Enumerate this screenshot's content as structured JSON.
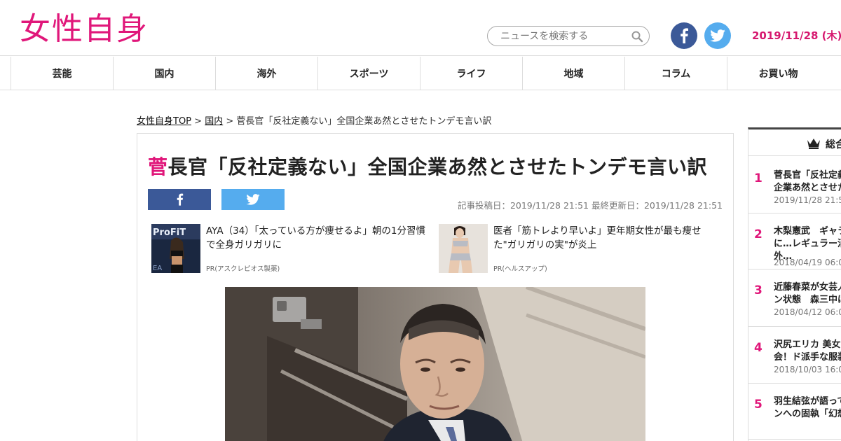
{
  "header": {
    "logo": "女性自身",
    "search_placeholder": "ニュースを検索する",
    "date": "2019/11/28 (木)"
  },
  "nav": {
    "items": [
      "芸能",
      "国内",
      "海外",
      "スポーツ",
      "ライフ",
      "地域",
      "コラム",
      "お買い物"
    ]
  },
  "breadcrumb": {
    "home": "女性自身TOP",
    "separator1": " > ",
    "category": "国内",
    "separator2": " > ",
    "current": "菅長官「反社定義ない」全国企業あ然とさせたトンデモ言い訳"
  },
  "article": {
    "title_first_char": "菅",
    "title_rest": "長官「反社定義ない」全国企業あ然とさせたトンデモ言い訳",
    "meta": "記事投稿日：2019/11/28 21:51 最終更新日：2019/11/28 21:51",
    "pr_items": [
      {
        "text": "AYA（34）「太っている方が痩せるよ」朝の1分習慣で全身ガリガリに",
        "sponsor": "PR(アスクレピオス製薬)",
        "thumb_text": "ProFiT"
      },
      {
        "text": "医者「筋トレより早いよ」更年期女性が最も痩せた\"ガリガリの実\"が炎上",
        "sponsor": "PR(ヘルスアップ)"
      }
    ]
  },
  "ranking": {
    "heading": "総合",
    "items": [
      {
        "num": "1",
        "title": "菅長官「反社定義\n企業あ然とさせた",
        "date": "2019/11/28 21:51"
      },
      {
        "num": "2",
        "title": "木梨憲武　ギャラ\nに…レギュラー消\n外…",
        "date": "2018/04/19 06:00"
      },
      {
        "num": "3",
        "title": "近藤春菜が女芸人\nン状態　森三中は",
        "date": "2018/04/12 06:00"
      },
      {
        "num": "4",
        "title": "沢尻エリカ 美女４\n会！ド派手な服装",
        "date": "2018/10/03 16:00"
      },
      {
        "num": "5",
        "title": "羽生結弦が語って\nンへの固執「幻想",
        "date": ""
      }
    ]
  },
  "colors": {
    "brand": "#e0177a",
    "facebook": "#3b5998",
    "twitter": "#55acee"
  }
}
